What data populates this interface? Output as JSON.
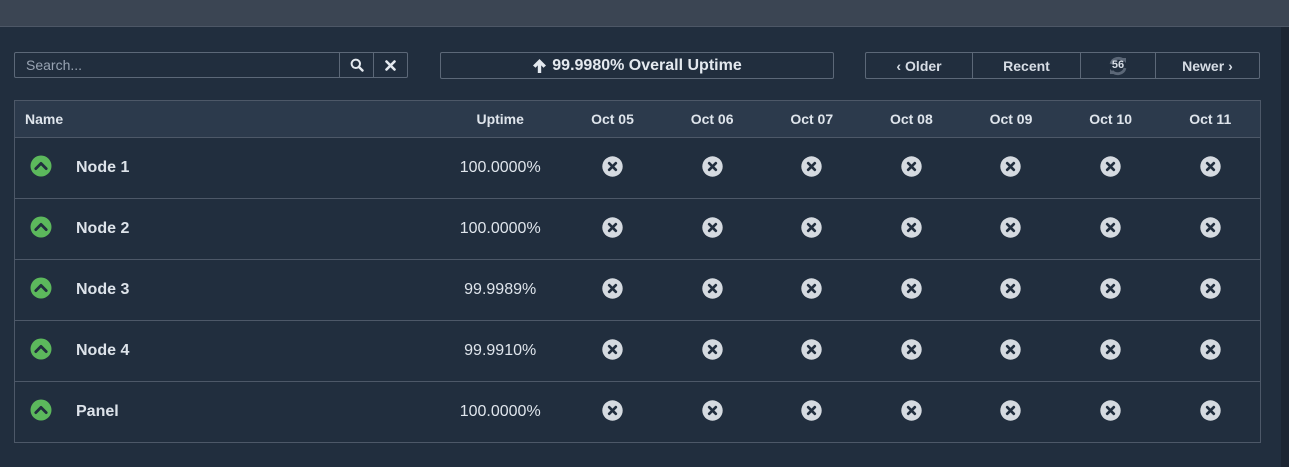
{
  "search": {
    "placeholder": "Search..."
  },
  "overall": {
    "text": "99.9980% Overall Uptime"
  },
  "nav": {
    "older": "Older",
    "recent": "Recent",
    "refresh_count": "56",
    "newer": "Newer"
  },
  "table": {
    "headers": {
      "name": "Name",
      "uptime": "Uptime",
      "days": [
        "Oct 05",
        "Oct 06",
        "Oct 07",
        "Oct 08",
        "Oct 09",
        "Oct 10",
        "Oct 11"
      ]
    },
    "rows": [
      {
        "name": "Node 1",
        "uptime": "100.0000%",
        "status": "up",
        "days": [
          "fail",
          "fail",
          "fail",
          "fail",
          "fail",
          "fail",
          "fail"
        ]
      },
      {
        "name": "Node 2",
        "uptime": "100.0000%",
        "status": "up",
        "days": [
          "fail",
          "fail",
          "fail",
          "fail",
          "fail",
          "fail",
          "fail"
        ]
      },
      {
        "name": "Node 3",
        "uptime": "99.9989%",
        "status": "up",
        "days": [
          "fail",
          "fail",
          "fail",
          "fail",
          "fail",
          "fail",
          "fail"
        ]
      },
      {
        "name": "Node 4",
        "uptime": "99.9910%",
        "status": "up",
        "days": [
          "fail",
          "fail",
          "fail",
          "fail",
          "fail",
          "fail",
          "fail"
        ]
      },
      {
        "name": "Panel",
        "uptime": "100.0000%",
        "status": "up",
        "days": [
          "fail",
          "fail",
          "fail",
          "fail",
          "fail",
          "fail",
          "fail"
        ]
      }
    ]
  },
  "colors": {
    "up": "#5cb85c",
    "day_icon": "#d5dae0",
    "background": "#212e3e"
  }
}
